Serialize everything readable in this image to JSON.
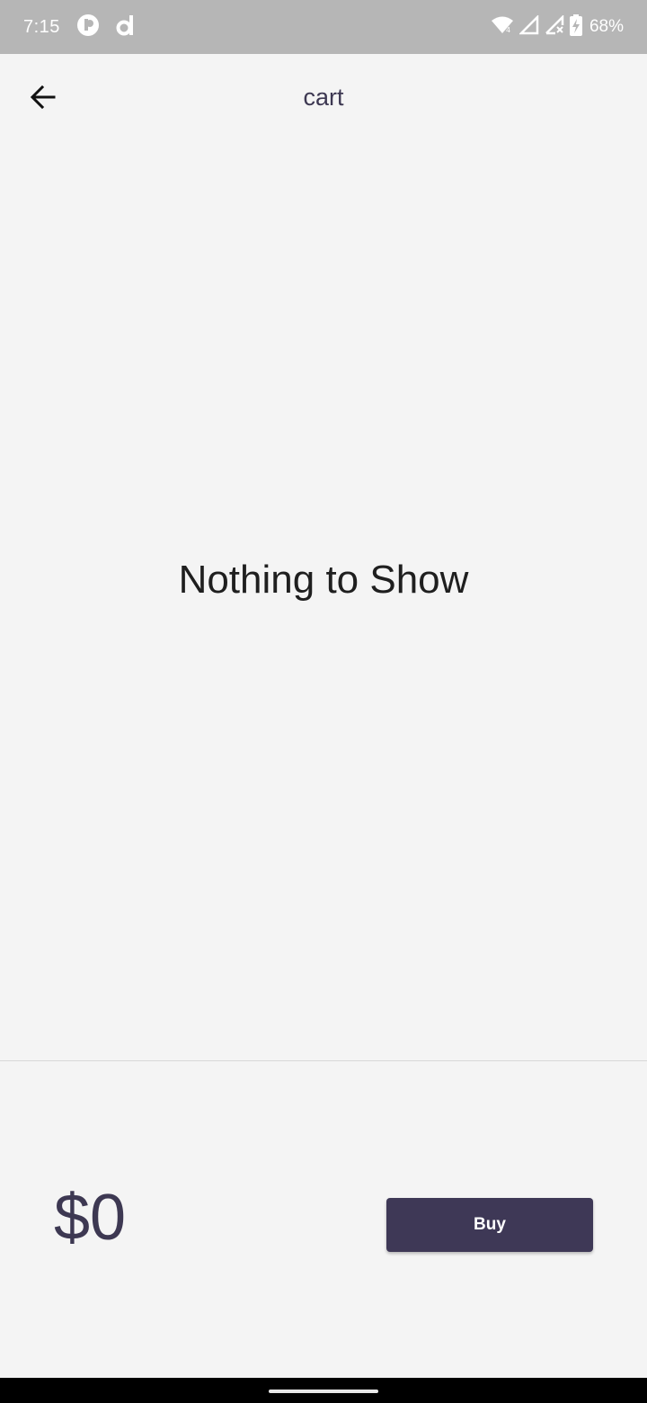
{
  "status_bar": {
    "time": "7:15",
    "battery": "68%",
    "icons": [
      "notification-app-icon",
      "d-app-icon",
      "wifi-icon",
      "signal-icon",
      "signal-no-data-icon",
      "battery-charging-icon"
    ]
  },
  "app_bar": {
    "title": "cart",
    "back_icon": "arrow-left-icon"
  },
  "content": {
    "empty_message": "Nothing to Show"
  },
  "checkout": {
    "total": "$0",
    "buy_label": "Buy"
  },
  "colors": {
    "accent": "#3e3856",
    "background": "#f4f4f4",
    "status_bar": "#b6b6b6"
  }
}
